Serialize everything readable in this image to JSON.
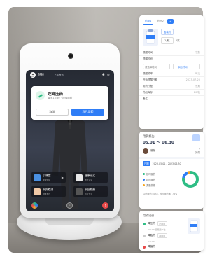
{
  "device": {
    "status_user": "爸爸",
    "status_center": "下载音乐",
    "dialog": {
      "title": "吃降压药",
      "subtitle": "每天13:30 · 提醒用药",
      "cancel_label": "取消",
      "confirm_label": "我已用药"
    },
    "tiles": [
      {
        "label": "小课堂",
        "sub": "健康知识"
      },
      {
        "label": "健康录式",
        "sub": "血压记录"
      },
      {
        "label": "安安检测",
        "sub": "测量血压"
      },
      {
        "label": "家庭相册",
        "sub": "照片分享"
      }
    ],
    "bottom_buttons": [
      "home",
      "voice",
      "sos"
    ]
  },
  "panel_medication": {
    "tabs": [
      "药品1",
      "药品2",
      "+"
    ],
    "drug_chip": "盒装药",
    "drug_dose": "1/粒",
    "drug_unit": "/次",
    "rows": [
      {
        "label": "提醒时间",
        "value": "次数"
      },
      {
        "label": "提醒时段",
        "value": ""
      }
    ],
    "time_placeholder": "请选择时间",
    "add_label": "+ 添加时间",
    "rows2": [
      {
        "label": "提醒频率",
        "value": "每天"
      },
      {
        "label": "开始提醒日期",
        "value": "2023-07-20"
      },
      {
        "label": "用药疗程",
        "value": "长期"
      },
      {
        "label": "药品库存",
        "value": "20/粒"
      },
      {
        "label": "备注",
        "value": ""
      }
    ]
  },
  "panel_report": {
    "title": "用药报告",
    "date_range": "05.01 ～ 06.30",
    "user_name": "爸爸",
    "user_right_1": "7",
    "user_right_2": "次/周",
    "date_label": "日期",
    "date_value": "2023.05.01 - 2023.06.30",
    "legend": [
      {
        "label": "按时服药",
        "color": "#2ebd85"
      },
      {
        "label": "延迟服药",
        "color": "#2f7df6"
      },
      {
        "label": "漏服药物",
        "color": "#f5a623"
      }
    ],
    "donut": {
      "on_time": 0.78,
      "late": 0.15,
      "missed": 0.07
    },
    "summary": "共计服药: 49次, 按时服药率: 78%"
  },
  "panel_records": {
    "title": "用药记录",
    "items": [
      {
        "name": "降压药",
        "status": "已服用",
        "time": "08:00 已服用 1粒",
        "done": true
      },
      {
        "name": "降脂药",
        "status": "待服用",
        "time": "13:30",
        "done": false
      },
      {
        "name": "降糖药",
        "status": "",
        "time": "",
        "done": true
      }
    ]
  },
  "colors": {
    "primary": "#2f7df6",
    "success": "#2ebd85",
    "warning": "#f5a623",
    "danger": "#e84a4a"
  }
}
